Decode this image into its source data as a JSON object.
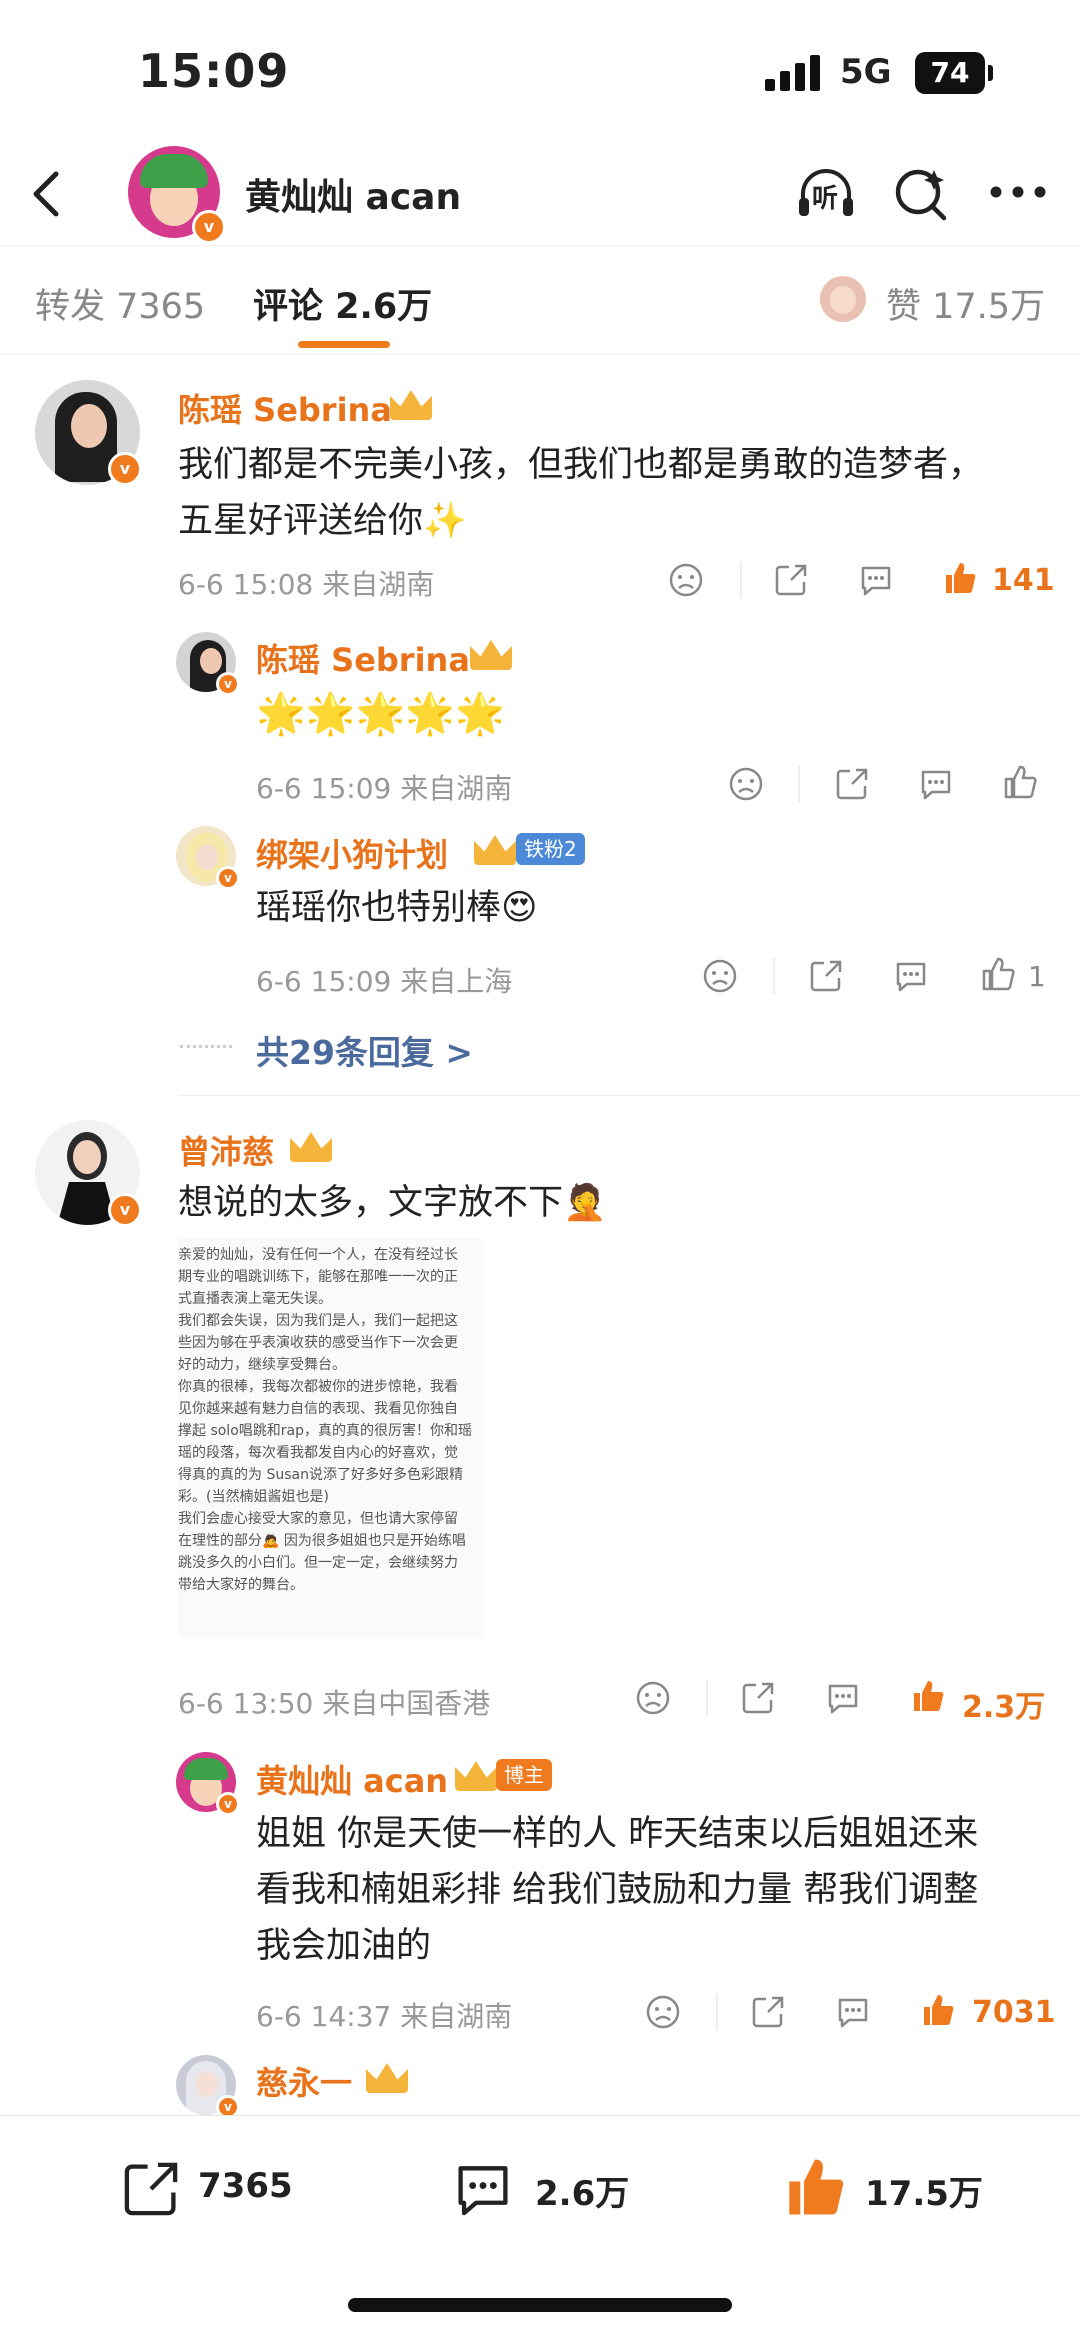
{
  "status_bar": {
    "time": "15:09",
    "network": "5G",
    "battery": "74"
  },
  "header": {
    "title": "黄灿灿 acan",
    "listen_label": "听"
  },
  "tabs": {
    "repost": "转发 7365",
    "comments": "评论 2.6万",
    "likes": "赞 17.5万"
  },
  "comments": [
    {
      "name": "陈瑶 Sebrina",
      "text_lines": [
        "我们都是不完美小孩，但我们也都是勇敢的造梦者，",
        "五星好评送给你✨"
      ],
      "meta": "6-6 15:08  来自湖南",
      "likes": "141",
      "replies": [
        {
          "name": "陈瑶 Sebrina",
          "text": "🌟🌟🌟🌟🌟",
          "meta": "6-6 15:09  来自湖南",
          "likes": ""
        },
        {
          "name": "绑架小狗计划",
          "badge": "铁粉2",
          "text": "瑶瑶你也特别棒😍",
          "meta": "6-6 15:09  来自上海",
          "likes": "1"
        }
      ],
      "more_replies": "共29条回复 >"
    },
    {
      "name": "曾沛慈",
      "text": "想说的太多，文字放不下🤦",
      "image_lines": [
        "亲爱的灿灿，没有任何一个人，在没有经过长",
        "期专业的唱跳训练下，能够在那唯一一次的正",
        "式直播表演上毫无失误。",
        "我们都会失误，因为我们是人，我们一起把这",
        "些因为够在乎表演收获的感受当作下一次会更",
        "好的动力，继续享受舞台。",
        "你真的很棒，我每次都被你的进步惊艳，我看",
        "见你越来越有魅力自信的表现、我看见你独自",
        "撑起 solo唱跳和rap，真的真的很厉害！你和瑶",
        "瑶的段落，每次看我都发自内心的好喜欢，觉",
        "得真的真的为 Susan说添了好多好多色彩跟精",
        "彩。(当然楠姐酱姐也是)",
        "我们会虚心接受大家的意见，但也请大家停留",
        "在理性的部分🙇 因为很多姐姐也只是开始练唱",
        "跳没多久的小白们。但一定一定，会继续努力",
        "带给大家好的舞台。"
      ],
      "meta": "6-6 13:50  来自中国香港",
      "likes": "2.3万",
      "replies": [
        {
          "name": "黄灿灿 acan",
          "badge": "博主",
          "text_lines": [
            "姐姐 你是天使一样的人 昨天结束以后姐姐还来",
            "看我和楠姐彩排 给我们鼓励和力量 帮我们调整",
            "我会加油的"
          ],
          "meta": "6-6 14:37  来自湖南",
          "likes": "7031"
        },
        {
          "name": "慈永一"
        }
      ]
    }
  ],
  "bottom_bar": {
    "repost": "7365",
    "comment": "2.6万",
    "like": "17.5万"
  },
  "colors": {
    "accent": "#e8731b",
    "link": "#4a6a9e",
    "verified": "#f07a1e"
  }
}
